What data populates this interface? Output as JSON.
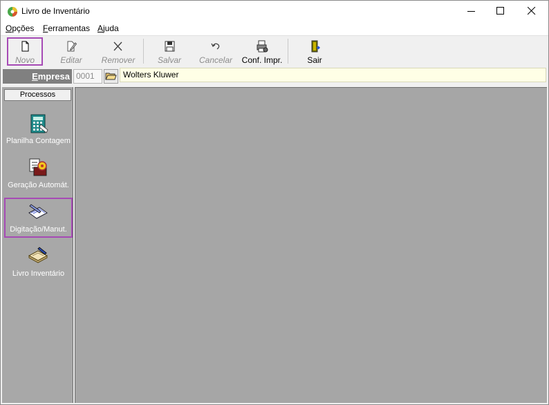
{
  "window": {
    "title": "Livro de Inventário"
  },
  "menu": {
    "items": [
      {
        "key": "O",
        "rest": "pções"
      },
      {
        "key": "F",
        "rest": "erramentas"
      },
      {
        "key": "A",
        "rest": "juda"
      }
    ]
  },
  "toolbar": {
    "novo": "Novo",
    "editar": "Editar",
    "remover": "Remover",
    "salvar": "Salvar",
    "cancelar": "Cancelar",
    "conf_impr": "Conf. Impr.",
    "sair": "Sair"
  },
  "empresa": {
    "label_key": "E",
    "label_rest": "mpresa",
    "code": "0001",
    "name": "Wolters Kluwer"
  },
  "processos": {
    "header": "Processos",
    "items": [
      {
        "label": "Planilha Contagem"
      },
      {
        "label": "Geração Automát."
      },
      {
        "label": "Digitação/Manut."
      },
      {
        "label": "Livro Inventário"
      }
    ]
  },
  "colors": {
    "highlight": "#a64ab5",
    "workspace": "#a6a6a6",
    "empresa_bg": "#ffffe6"
  }
}
